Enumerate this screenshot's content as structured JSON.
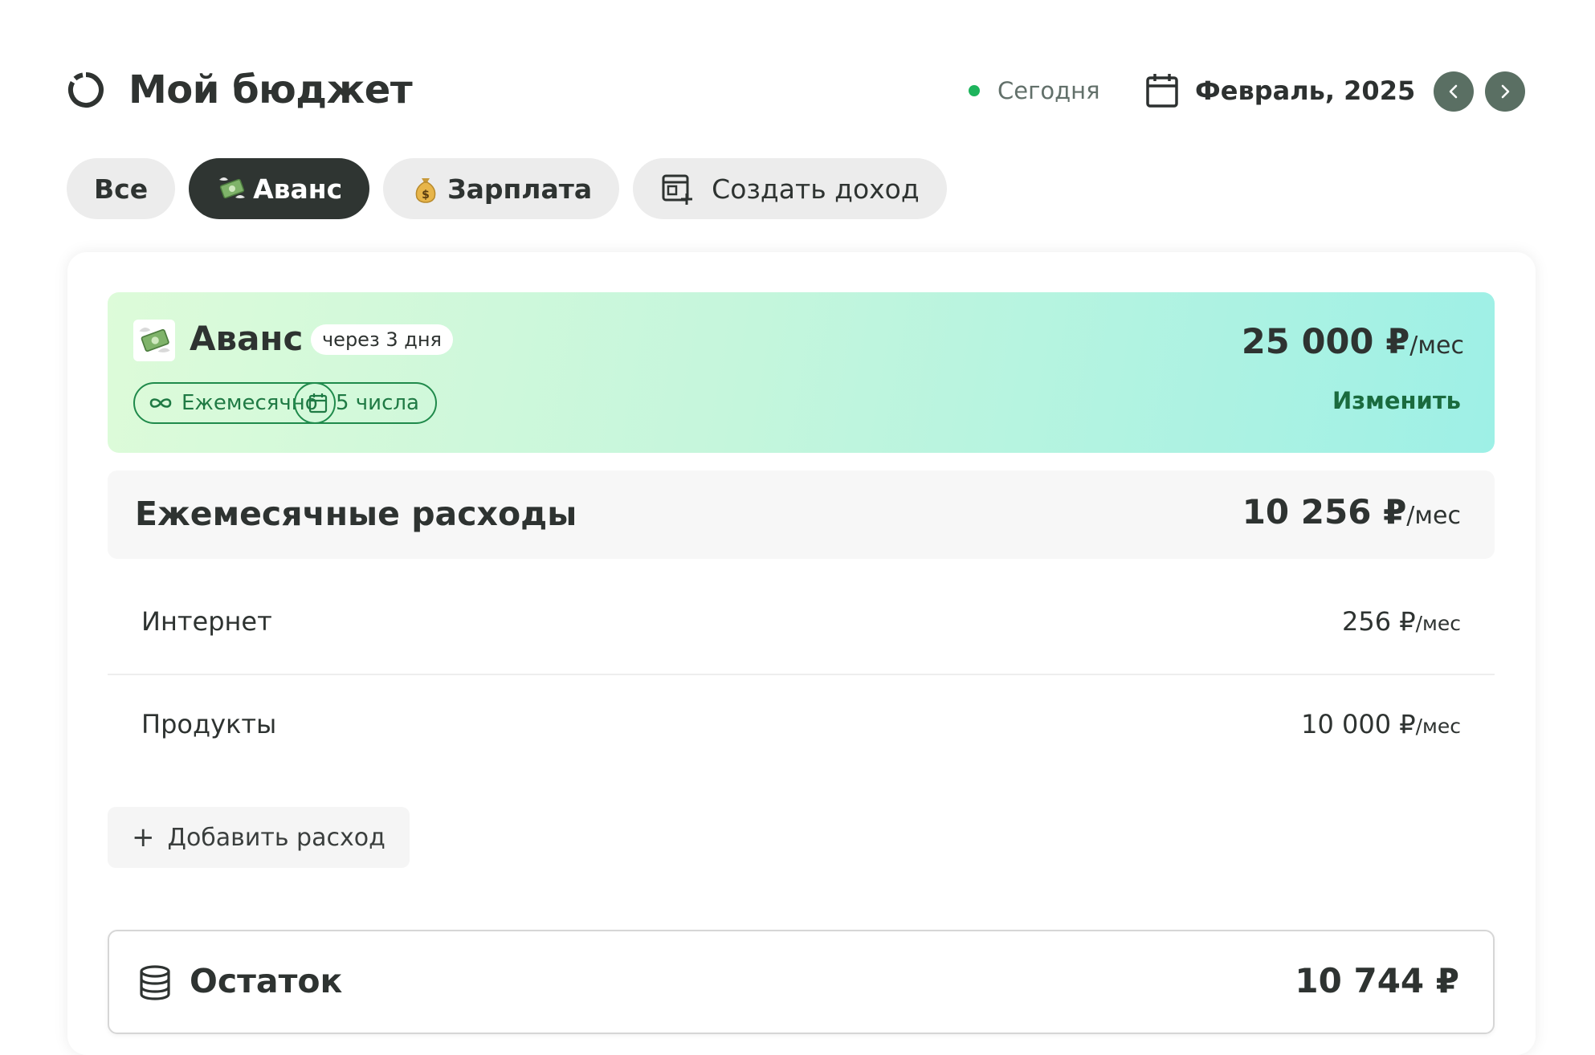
{
  "header": {
    "title": "Мой бюджет",
    "today_label": "Сегодня",
    "month_label": "Февраль, 2025"
  },
  "tabs": [
    {
      "label": "Все",
      "icon": null,
      "active": false
    },
    {
      "label": "Аванс",
      "icon": "money-with-wings-emoji",
      "active": true
    },
    {
      "label": "Зарплата",
      "icon": "money-bag-emoji",
      "active": false
    },
    {
      "label": "Создать доход",
      "icon": "create-income-icon",
      "active": false
    }
  ],
  "income": {
    "icon": "money-with-wings-emoji",
    "title": "Аванс",
    "badge": "через 3 дня",
    "amount": "25 000 ₽",
    "amount_suffix": "/мес",
    "chips": [
      {
        "icon": "infinity-icon",
        "label": "Ежемесячно"
      },
      {
        "icon": "calendar-icon",
        "label": "5 числа"
      }
    ],
    "edit_label": "Изменить"
  },
  "expenses": {
    "title": "Ежемесячные расходы",
    "total": "10 256 ₽",
    "total_suffix": "/мес",
    "items": [
      {
        "name": "Интернет",
        "amount": "256 ₽",
        "suffix": "/мес"
      },
      {
        "name": "Продукты",
        "amount": "10 000 ₽",
        "suffix": "/мес"
      }
    ],
    "add_label": "Добавить расход"
  },
  "balance": {
    "icon": "database-icon",
    "title": "Остаток",
    "amount": "10 744 ₽"
  },
  "colors": {
    "accent_green": "#1db45c",
    "dark": "#2f3532",
    "nav_button": "#5a6f63",
    "chip_green": "#1f8a4b"
  }
}
